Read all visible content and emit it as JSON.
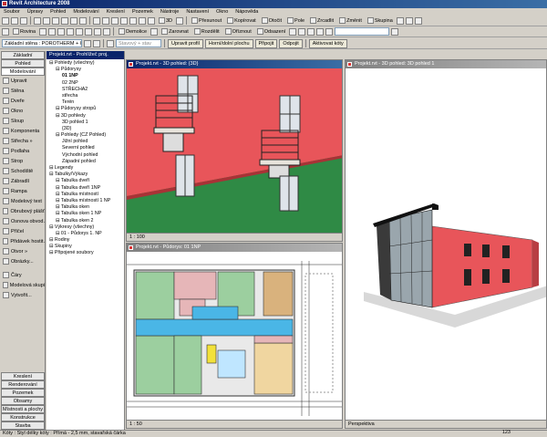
{
  "app": {
    "title": "Revit Architecture 2008"
  },
  "menu": [
    "Soubor",
    "Úpravy",
    "Pohled",
    "Modelování",
    "Kreslení",
    "Pozemek",
    "Nástroje",
    "Nastavení",
    "Okno",
    "Nápověda"
  ],
  "toolbar1": {
    "view3d_label": "3D",
    "move": "Přesunout",
    "copy": "Kopírovat",
    "rotate": "Otočit",
    "array": "Pole",
    "mirror": "Zrcadlit",
    "resize": "Změnit",
    "group": "Skupina"
  },
  "toolbar2": {
    "plane": "Rovina",
    "demolish": "Demolice",
    "align": "Zarovnat",
    "split": "Rozdělit",
    "trim": "Oříznout",
    "offset": "Odsazení"
  },
  "toolbar3": {
    "type_select": "Základní stěna : POROTHERM + O",
    "instance": "Stavový + stav",
    "edit_profile": "Upravit profil",
    "top_base": "Horní/dolní plochu",
    "attach": "Připojit",
    "detach": "Odpojit",
    "activate": "Aktivovat kóty"
  },
  "left_tabs": {
    "basic": "Základní",
    "view": "Pohled",
    "modeling": "Modelování"
  },
  "left_tools": [
    "Upravit",
    "Stěna",
    "Dveře",
    "Okno",
    "Sloup",
    "Komponenta",
    "Střecha »",
    "Podlaha",
    "Strop",
    "Schodiště",
    "Zábradlí",
    "Rampa",
    "Modelový text",
    "Obrubový plášť",
    "Osnova obvod.",
    "Příčel",
    "Přidávek hostit.",
    "Otvor »",
    "Obrázky..."
  ],
  "left_tools2": [
    "Čáry",
    "Modelová skupi",
    "Vytvořit..."
  ],
  "left_bottom_tabs": [
    "Kreslení",
    "Renderování",
    "Pozemek",
    "Obsamy",
    "Místnosti a plochy",
    "Konstrukce",
    "Stavba"
  ],
  "browser": {
    "header": "Projekt.rvt - Prohlížeč proj.",
    "nodes": [
      {
        "label": "Pohledy (všechny)",
        "depth": 0,
        "bold": false
      },
      {
        "label": "Půdorysy",
        "depth": 1,
        "bold": false
      },
      {
        "label": "01 1NP",
        "depth": 2,
        "bold": true
      },
      {
        "label": "02 2NP",
        "depth": 2,
        "bold": false
      },
      {
        "label": "STŘECHA2",
        "depth": 2,
        "bold": false
      },
      {
        "label": "střecha",
        "depth": 2,
        "bold": false
      },
      {
        "label": "Terén",
        "depth": 2,
        "bold": false
      },
      {
        "label": "Půdorysy stropů",
        "depth": 1,
        "bold": false
      },
      {
        "label": "3D pohledy",
        "depth": 1,
        "bold": false
      },
      {
        "label": "3D pohled 1",
        "depth": 2,
        "bold": false
      },
      {
        "label": "{3D}",
        "depth": 2,
        "bold": false
      },
      {
        "label": "Pohledy (CZ Pohled)",
        "depth": 1,
        "bold": false
      },
      {
        "label": "Jižní pohled",
        "depth": 2,
        "bold": false
      },
      {
        "label": "Severní pohled",
        "depth": 2,
        "bold": false
      },
      {
        "label": "Východní pohled",
        "depth": 2,
        "bold": false
      },
      {
        "label": "Západní pohled",
        "depth": 2,
        "bold": false
      },
      {
        "label": "Legendy",
        "depth": 0,
        "bold": false
      },
      {
        "label": "Tabulky/Výkazy",
        "depth": 0,
        "bold": false
      },
      {
        "label": "Tabulka dveří",
        "depth": 1,
        "bold": false
      },
      {
        "label": "Tabulka dveří 1NP",
        "depth": 1,
        "bold": false
      },
      {
        "label": "Tabulka místností",
        "depth": 1,
        "bold": false
      },
      {
        "label": "Tabulka místností 1 NP",
        "depth": 1,
        "bold": false
      },
      {
        "label": "Tabulka oken",
        "depth": 1,
        "bold": false
      },
      {
        "label": "Tabulka oken 1 NP",
        "depth": 1,
        "bold": false
      },
      {
        "label": "Tabulka oken 2",
        "depth": 1,
        "bold": false
      },
      {
        "label": "Výkresy (všechny)",
        "depth": 0,
        "bold": false
      },
      {
        "label": "01 - Půdorys 1. NP",
        "depth": 1,
        "bold": false
      },
      {
        "label": "Rodiny",
        "depth": 0,
        "bold": false
      },
      {
        "label": "Skupiny",
        "depth": 0,
        "bold": false
      },
      {
        "label": "Připojené soubory",
        "depth": 0,
        "bold": false
      }
    ]
  },
  "windows": {
    "view3d": {
      "title": "Projekt.rvt - 3D pohled: {3D}",
      "scale": "1 : 100"
    },
    "plan": {
      "title": "Projekt.rvt - Půdorys: 01 1NP",
      "scale": "1 : 50"
    },
    "persp": {
      "title": "Projekt.rvt - 3D pohled: 3D pohled 1",
      "scale": "Perspektiva"
    }
  },
  "status": {
    "text": "Kóty : Styl délky kóty : Přímá - 2,5 mm, stavařská čárka",
    "right": "123"
  },
  "colors": {
    "wall": "#e8555a",
    "ground": "#2f8a45",
    "sky": "#ffffff",
    "title_active": "#0a246a",
    "chrome": "#d4d0c8"
  }
}
